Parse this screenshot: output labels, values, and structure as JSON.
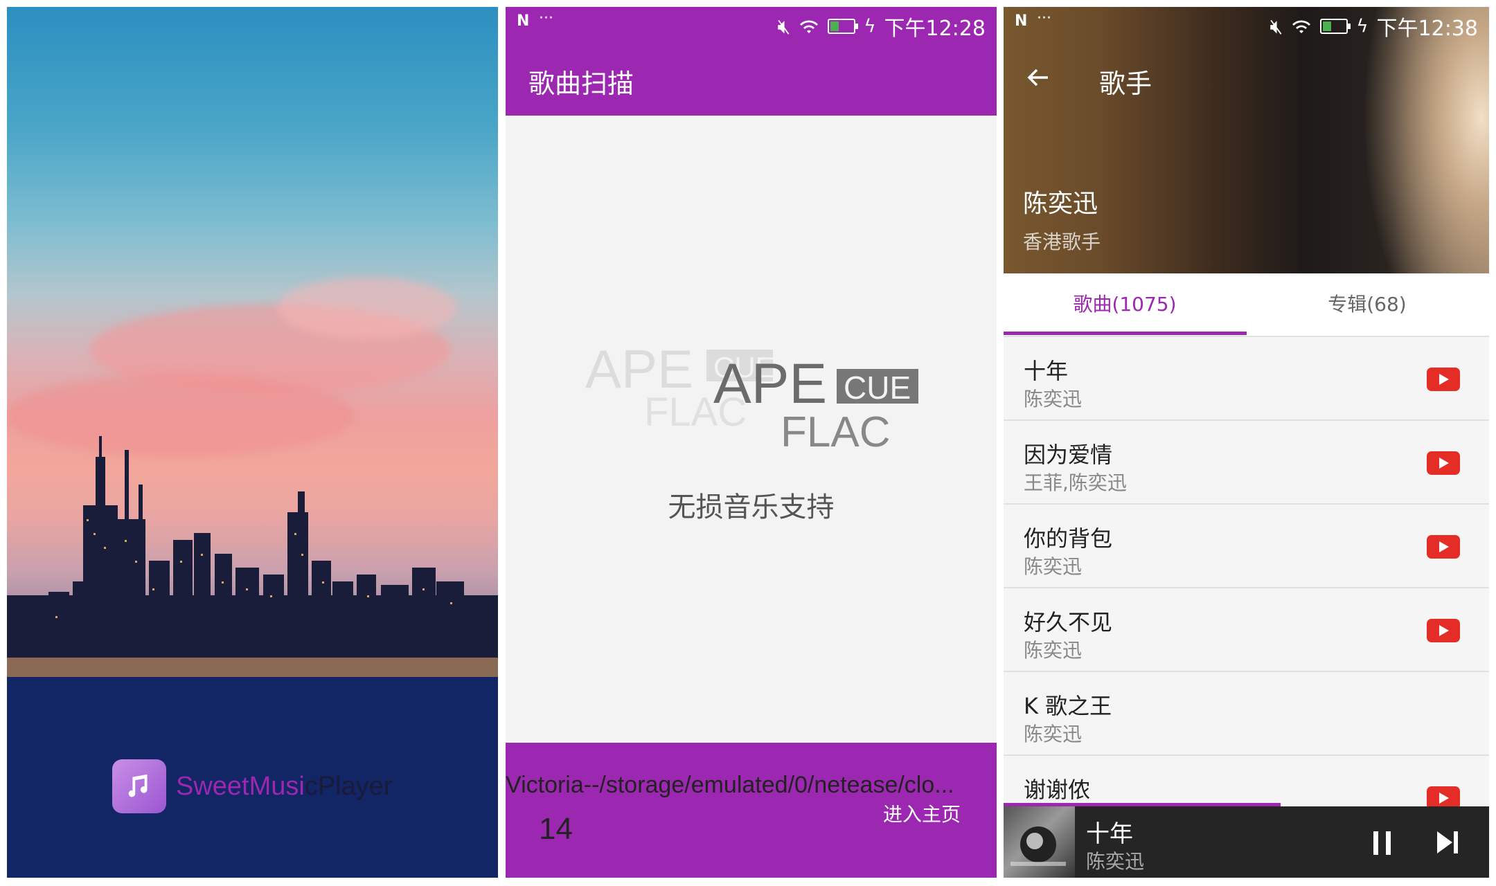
{
  "splash": {
    "app_name_part1": "SweetMusi",
    "app_name_part2": "cPlayer"
  },
  "scan": {
    "status_time": "下午12:28",
    "title": "歌曲扫描",
    "logo_ape": "APE",
    "logo_cue": "CUE",
    "logo_flac": "FLAC",
    "lossless_label": "无损音乐支持",
    "current_path": "Victoria--/storage/emulated/0/netease/clo...",
    "scanned_count": "14",
    "enter_home": "进入主页"
  },
  "singer": {
    "status_time": "下午12:38",
    "title": "歌手",
    "name": "陈奕迅",
    "description": "香港歌手",
    "tabs": [
      {
        "label": "歌曲(1075)"
      },
      {
        "label": "专辑(68)"
      }
    ],
    "songs": [
      {
        "title": "十年",
        "artist": "陈奕迅"
      },
      {
        "title": "因为爱情",
        "artist": "王菲,陈奕迅"
      },
      {
        "title": "你的背包",
        "artist": "陈奕迅"
      },
      {
        "title": "好久不见",
        "artist": "陈奕迅"
      },
      {
        "title": "K 歌之王",
        "artist": "陈奕迅"
      },
      {
        "title": "谢谢侬",
        "artist": ""
      }
    ],
    "now_playing": {
      "title": "十年",
      "artist": "陈奕迅",
      "progress": 0.57
    }
  },
  "colors": {
    "accent": "#9c27b0",
    "youtube_red": "#e52d27"
  }
}
